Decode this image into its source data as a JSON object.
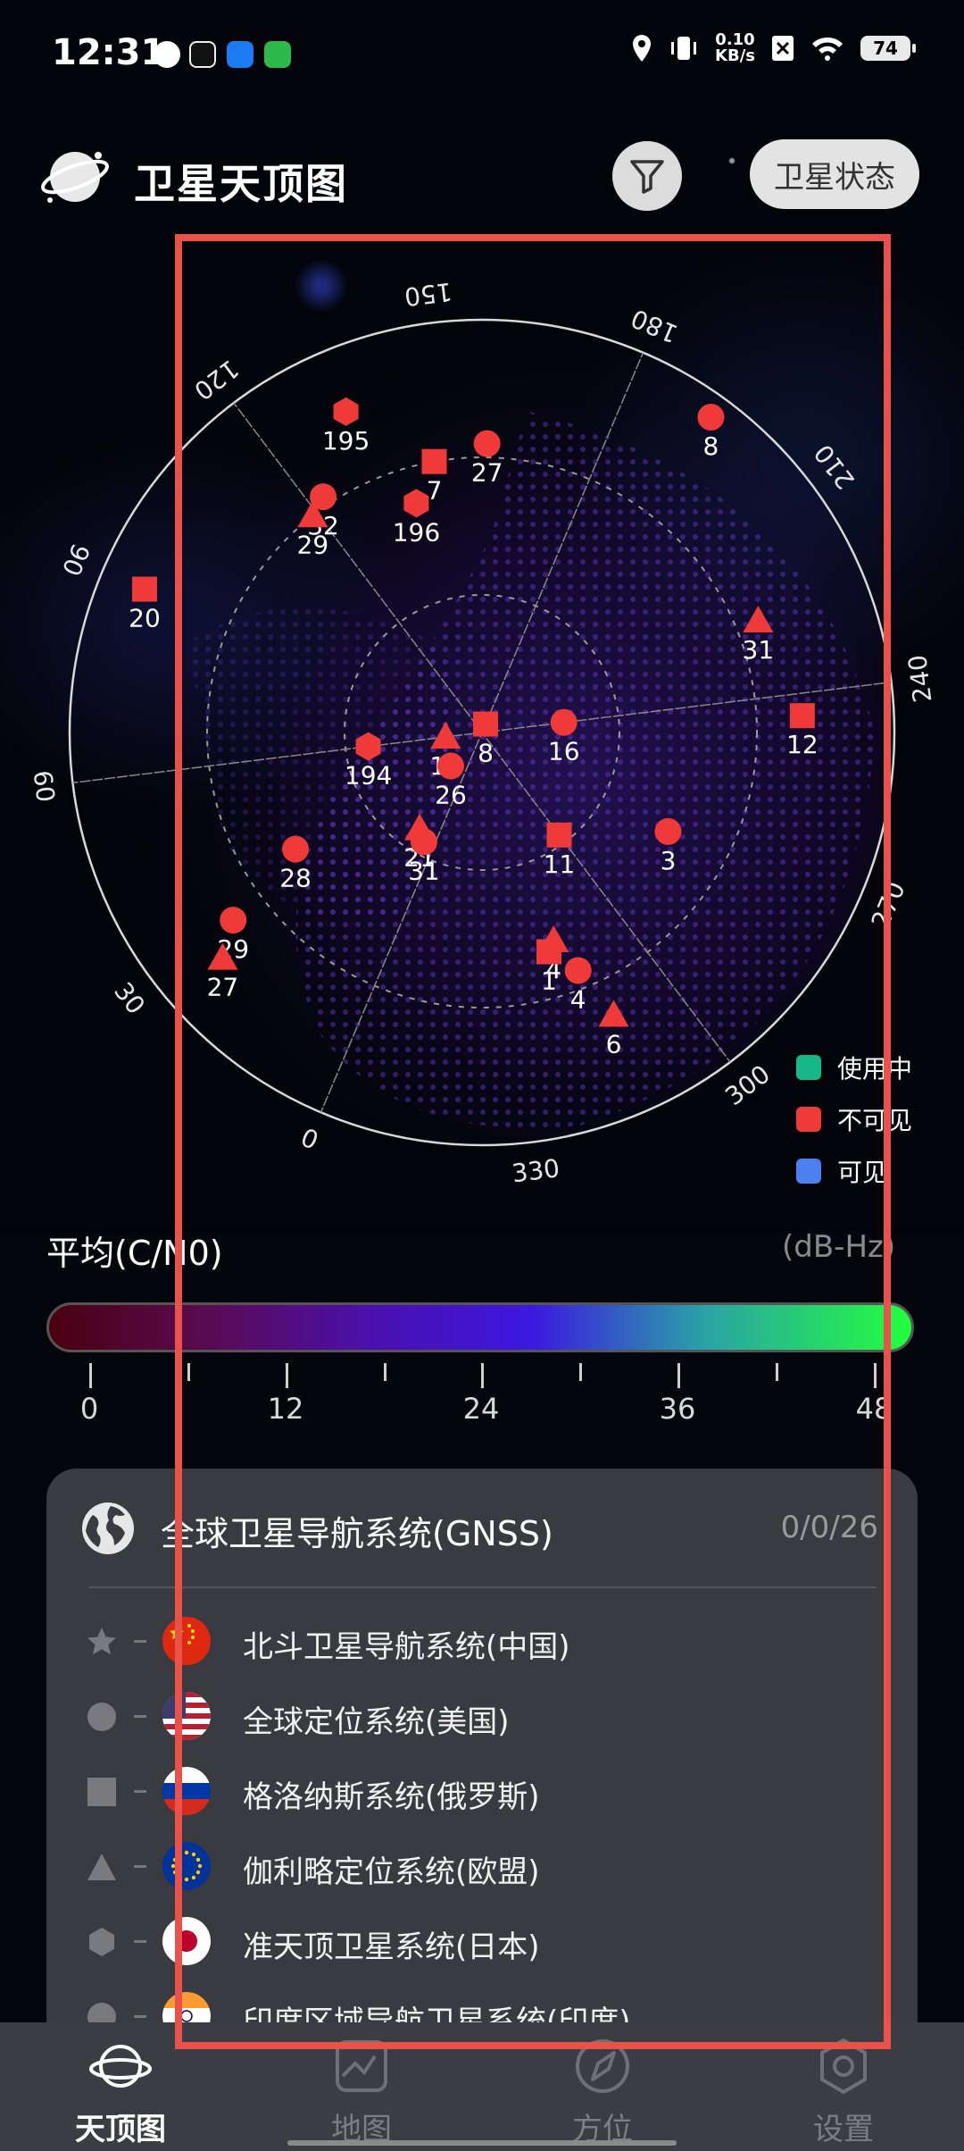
{
  "status_bar": {
    "time": "12:31",
    "network_speed": "0.10",
    "network_unit": "KB/s",
    "battery": "74"
  },
  "header": {
    "title": "卫星天顶图",
    "filter_button": "filter-icon",
    "status_button": "卫星状态"
  },
  "skyplot": {
    "azimuth_labels": [
      {
        "text": "0",
        "angle": 0
      },
      {
        "text": "30",
        "angle": 30
      },
      {
        "text": "60",
        "angle": 60
      },
      {
        "text": "90",
        "angle": 90
      },
      {
        "text": "120",
        "angle": 120
      },
      {
        "text": "150",
        "angle": 150
      },
      {
        "text": "180",
        "angle": 180
      },
      {
        "text": "210",
        "angle": 210
      },
      {
        "text": "240",
        "angle": 240
      },
      {
        "text": "270",
        "angle": 270
      },
      {
        "text": "300",
        "angle": 300
      },
      {
        "text": "330",
        "angle": 330
      }
    ],
    "satellites": [
      {
        "id": "8",
        "shape": "circle",
        "azimuth": 193,
        "elevation": 5
      },
      {
        "id": "31",
        "shape": "triangle",
        "azimuth": 225,
        "elevation": 25
      },
      {
        "id": "12",
        "shape": "square",
        "azimuth": 244,
        "elevation": 20
      },
      {
        "id": "27",
        "shape": "circle",
        "azimuth": 158,
        "elevation": 27
      },
      {
        "id": "7",
        "shape": "square",
        "azimuth": 147,
        "elevation": 30
      },
      {
        "id": "195",
        "shape": "hexagon",
        "azimuth": 134,
        "elevation": 14
      },
      {
        "id": "196",
        "shape": "hexagon",
        "azimuth": 141,
        "elevation": 38
      },
      {
        "id": "32",
        "shape": "circle",
        "azimuth": 123,
        "elevation": 28
      },
      {
        "id": "29",
        "shape": "triangle",
        "azimuth": 119,
        "elevation": 30
      },
      {
        "id": "16",
        "shape": "circle",
        "azimuth": 240,
        "elevation": 72
      },
      {
        "id": "8",
        "shape": "square",
        "azimuth": 180,
        "elevation": 88
      },
      {
        "id": "3",
        "shape": "circle",
        "azimuth": 275,
        "elevation": 44
      },
      {
        "id": "11",
        "shape": "square",
        "azimuth": 300,
        "elevation": 62
      },
      {
        "id": "19",
        "shape": "triangle",
        "azimuth": 60,
        "elevation": 82
      },
      {
        "id": "194",
        "shape": "hexagon",
        "azimuth": 60,
        "elevation": 65
      },
      {
        "id": "26",
        "shape": "circle",
        "azimuth": 20,
        "elevation": 80
      },
      {
        "id": "4",
        "shape": "triangle",
        "azimuth": 318,
        "elevation": 42
      },
      {
        "id": "1",
        "shape": "square",
        "azimuth": 320,
        "elevation": 40
      },
      {
        "id": "4",
        "shape": "circle",
        "azimuth": 315,
        "elevation": 34
      },
      {
        "id": "6",
        "shape": "triangle",
        "azimuth": 312,
        "elevation": 22
      },
      {
        "id": "20",
        "shape": "square",
        "azimuth": 90,
        "elevation": 10
      },
      {
        "id": "21",
        "shape": "triangle",
        "azimuth": 10,
        "elevation": 65
      },
      {
        "id": "31",
        "shape": "circle",
        "azimuth": 5,
        "elevation": 63
      },
      {
        "id": "28",
        "shape": "circle",
        "azimuth": 35,
        "elevation": 42
      },
      {
        "id": "29",
        "shape": "circle",
        "azimuth": 30,
        "elevation": 22
      },
      {
        "id": "27",
        "shape": "triangle",
        "azimuth": 26,
        "elevation": 15
      }
    ]
  },
  "legend": [
    {
      "label": "使用中",
      "color": "#16b889"
    },
    {
      "label": "不可见",
      "color": "#f03a3a"
    },
    {
      "label": "可见",
      "color": "#4a80f0"
    }
  ],
  "cn0": {
    "label": "平均(C/N0)",
    "unit": "(dB-Hz)",
    "tick_labels": [
      "0",
      "12",
      "24",
      "36",
      "48"
    ]
  },
  "gnss": {
    "title": "全球卫星导航系统(GNSS)",
    "count": "0/0/26",
    "systems": [
      {
        "label": "北斗卫星导航系统(中国)",
        "symbol": "star",
        "flag": "china"
      },
      {
        "label": "全球定位系统(美国)",
        "symbol": "circle",
        "flag": "usa"
      },
      {
        "label": "格洛纳斯系统(俄罗斯)",
        "symbol": "square",
        "flag": "russia"
      },
      {
        "label": "伽利略定位系统(欧盟)",
        "symbol": "triangle",
        "flag": "eu"
      },
      {
        "label": "准天顶卫星系统(日本)",
        "symbol": "hexagon",
        "flag": "japan"
      },
      {
        "label": "印度区域导航卫星系统(印度)",
        "symbol": "circle",
        "flag": "india"
      }
    ]
  },
  "nav": [
    {
      "label": "天顶图",
      "icon": "planet-icon",
      "active": true
    },
    {
      "label": "地图",
      "icon": "map-icon",
      "active": false
    },
    {
      "label": "方位",
      "icon": "compass-icon",
      "active": false
    },
    {
      "label": "设置",
      "icon": "settings-icon",
      "active": false
    }
  ],
  "colors": {
    "satellite": "#f03a3a",
    "panel": "#3a3b40"
  }
}
